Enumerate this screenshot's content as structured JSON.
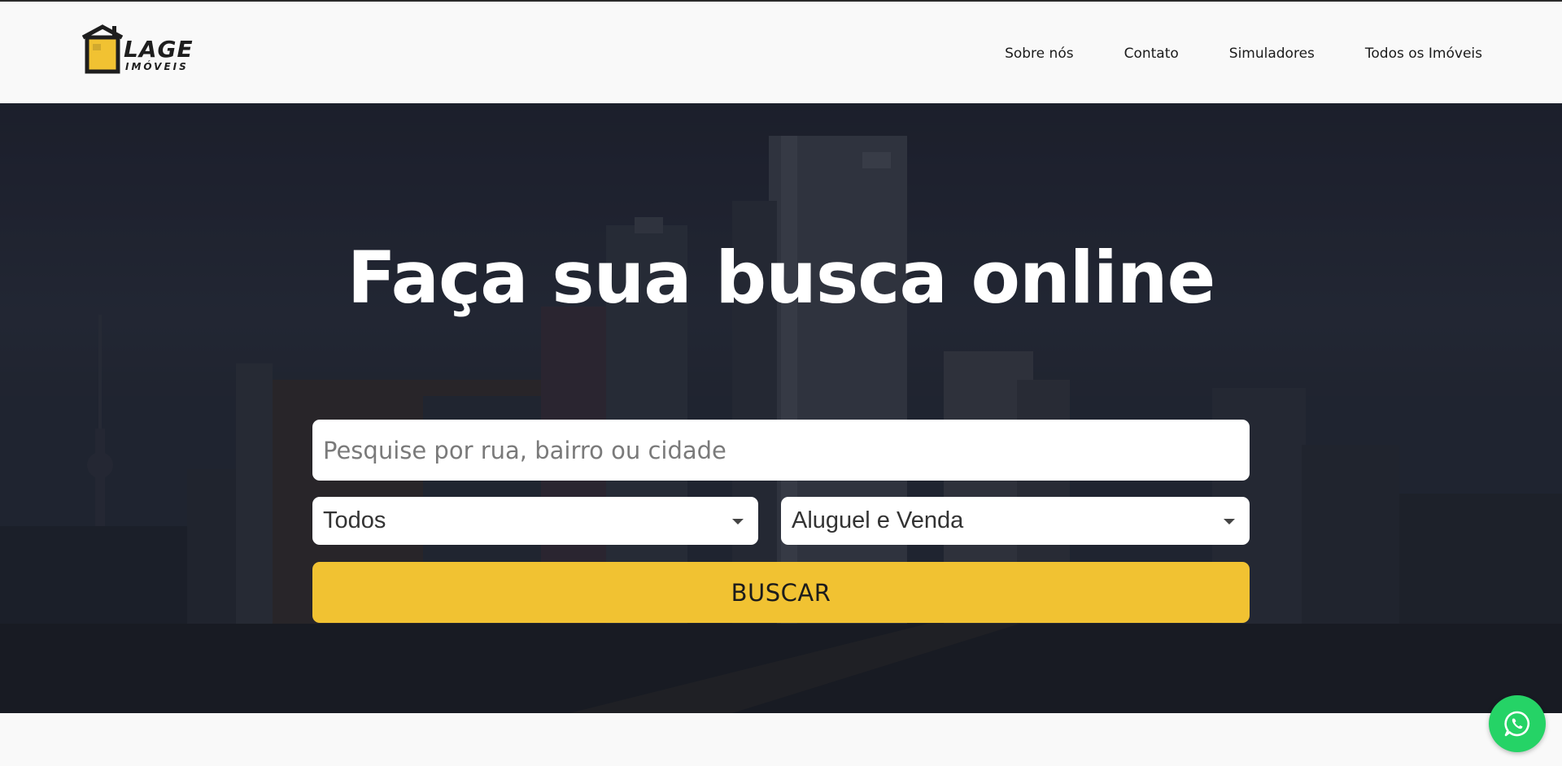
{
  "brand": {
    "logo_main": "LAGE",
    "logo_sub": "IMÓVEIS",
    "accent_color": "#f1c232"
  },
  "nav": {
    "items": [
      {
        "label": "Sobre nós"
      },
      {
        "label": "Contato"
      },
      {
        "label": "Simuladores"
      },
      {
        "label": "Todos os Imóveis"
      }
    ]
  },
  "hero": {
    "title": "Faça sua busca online",
    "search": {
      "placeholder": "Pesquise por rua, bairro ou cidade",
      "value": ""
    },
    "property_type_select": {
      "selected": "Todos"
    },
    "transaction_select": {
      "selected": "Aluguel e Venda"
    },
    "submit_label": "BUSCAR"
  },
  "floating": {
    "whatsapp_icon": "whatsapp-icon",
    "whatsapp_color": "#25d366"
  }
}
